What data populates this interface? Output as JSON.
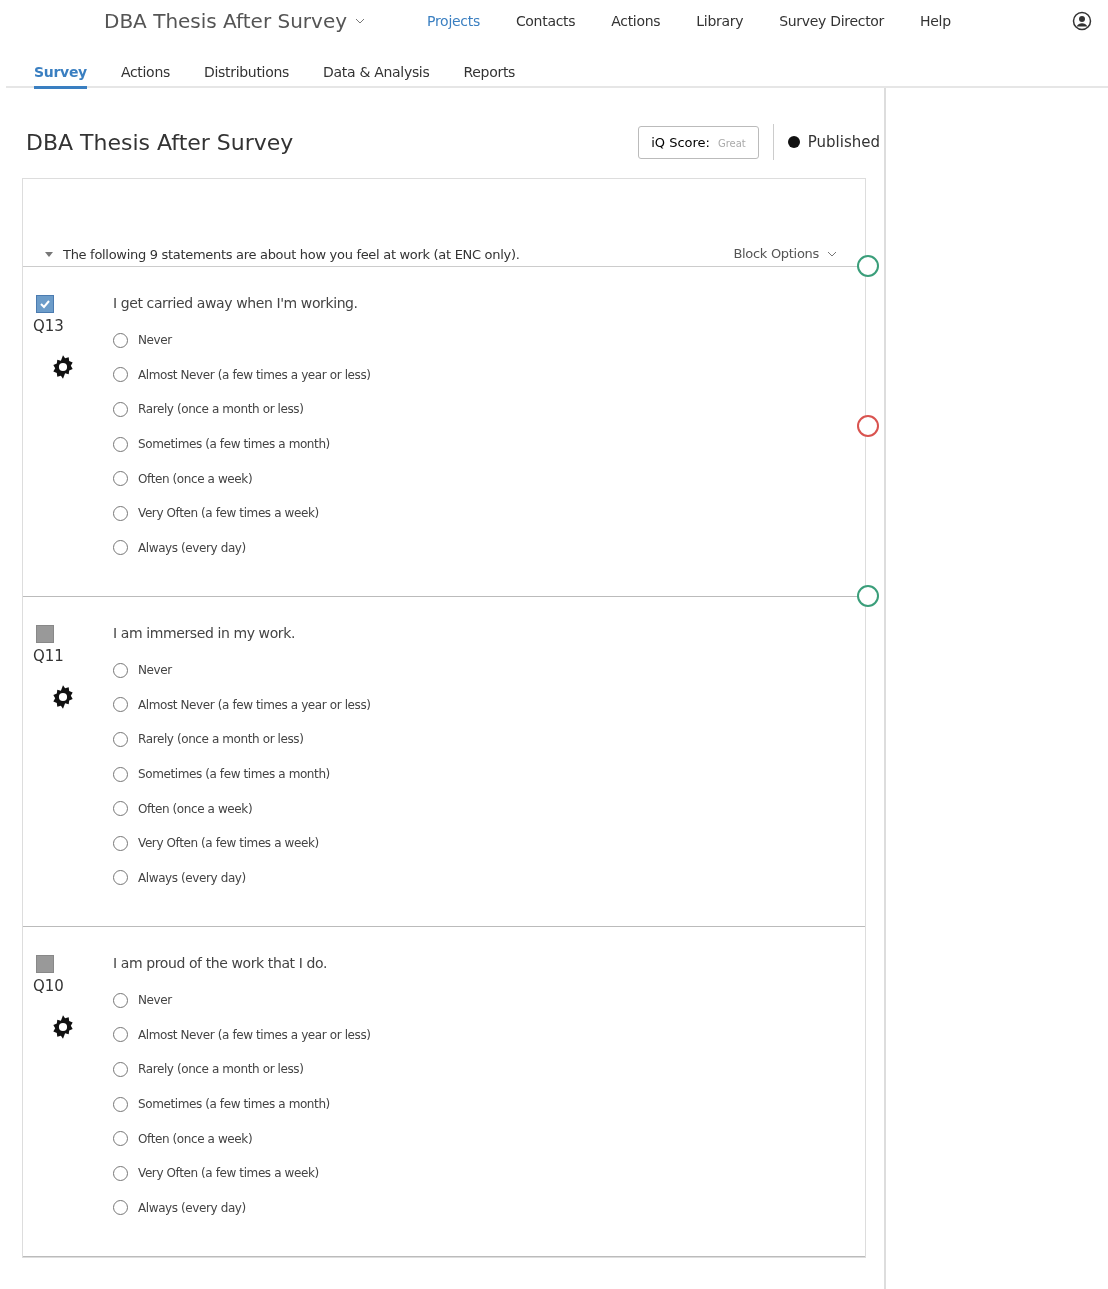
{
  "topbar": {
    "project_title": "DBA Thesis After Survey",
    "nav": [
      {
        "label": "Projects",
        "selected": true
      },
      {
        "label": "Contacts",
        "selected": false
      },
      {
        "label": "Actions",
        "selected": false
      },
      {
        "label": "Library",
        "selected": false
      },
      {
        "label": "Survey Director",
        "selected": false
      },
      {
        "label": "Help",
        "selected": false
      }
    ]
  },
  "tabs": [
    {
      "label": "Survey",
      "selected": true
    },
    {
      "label": "Actions",
      "selected": false
    },
    {
      "label": "Distributions",
      "selected": false
    },
    {
      "label": "Data & Analysis",
      "selected": false
    },
    {
      "label": "Reports",
      "selected": false
    }
  ],
  "survey": {
    "title": "DBA Thesis After Survey",
    "iq_score_label": "iQ Score:",
    "iq_score_value": "Great",
    "status": "Published"
  },
  "block": {
    "description": "The following 9 statements are about how you feel at work (at ENC only).",
    "options_label": "Block Options",
    "rail_markers": [
      {
        "color": "#3a9e7a"
      },
      {
        "color": "#d9534f"
      },
      {
        "color": "#3a9e7a"
      }
    ],
    "questions": [
      {
        "number": "Q13",
        "checked": true,
        "text": "I get carried away when I'm working.",
        "choices": [
          "Never",
          "Almost Never (a few times a year or less)",
          "Rarely (once a month or less)",
          "Sometimes (a few times a month)",
          "Often (once a week)",
          "Very Often (a few times a week)",
          "Always (every day)"
        ]
      },
      {
        "number": "Q11",
        "checked": false,
        "text": "I am immersed in my work.",
        "choices": [
          "Never",
          "Almost Never (a few times a year or less)",
          "Rarely (once a month or less)",
          "Sometimes (a few times a month)",
          "Often (once a week)",
          "Very Often (a few times a week)",
          "Always (every day)"
        ]
      },
      {
        "number": "Q10",
        "checked": false,
        "text": "I am proud of the work that I do.",
        "choices": [
          "Never",
          "Almost Never (a few times a year or less)",
          "Rarely (once a month or less)",
          "Sometimes (a few times a month)",
          "Often (once a week)",
          "Very Often (a few times a week)",
          "Always (every day)"
        ]
      }
    ]
  }
}
